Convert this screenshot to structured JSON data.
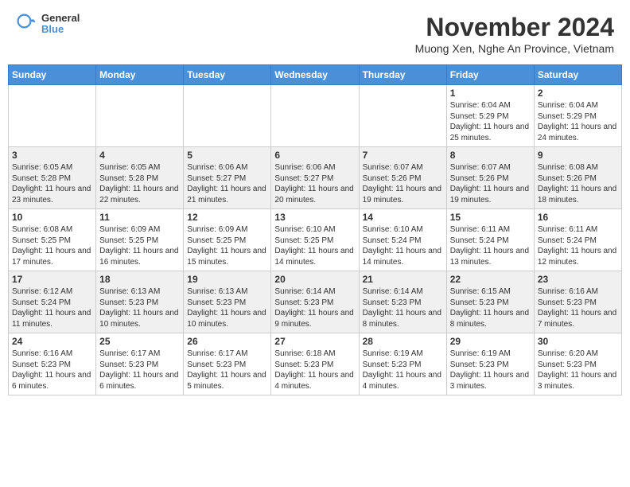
{
  "header": {
    "logo": {
      "text_general": "General",
      "text_blue": "Blue"
    },
    "title": "November 2024",
    "location": "Muong Xen, Nghe An Province, Vietnam"
  },
  "calendar": {
    "weekdays": [
      "Sunday",
      "Monday",
      "Tuesday",
      "Wednesday",
      "Thursday",
      "Friday",
      "Saturday"
    ],
    "weeks": [
      [
        {
          "day": "",
          "info": ""
        },
        {
          "day": "",
          "info": ""
        },
        {
          "day": "",
          "info": ""
        },
        {
          "day": "",
          "info": ""
        },
        {
          "day": "",
          "info": ""
        },
        {
          "day": "1",
          "info": "Sunrise: 6:04 AM\nSunset: 5:29 PM\nDaylight: 11 hours\nand 25 minutes."
        },
        {
          "day": "2",
          "info": "Sunrise: 6:04 AM\nSunset: 5:29 PM\nDaylight: 11 hours\nand 24 minutes."
        }
      ],
      [
        {
          "day": "3",
          "info": "Sunrise: 6:05 AM\nSunset: 5:28 PM\nDaylight: 11 hours\nand 23 minutes."
        },
        {
          "day": "4",
          "info": "Sunrise: 6:05 AM\nSunset: 5:28 PM\nDaylight: 11 hours\nand 22 minutes."
        },
        {
          "day": "5",
          "info": "Sunrise: 6:06 AM\nSunset: 5:27 PM\nDaylight: 11 hours\nand 21 minutes."
        },
        {
          "day": "6",
          "info": "Sunrise: 6:06 AM\nSunset: 5:27 PM\nDaylight: 11 hours\nand 20 minutes."
        },
        {
          "day": "7",
          "info": "Sunrise: 6:07 AM\nSunset: 5:26 PM\nDaylight: 11 hours\nand 19 minutes."
        },
        {
          "day": "8",
          "info": "Sunrise: 6:07 AM\nSunset: 5:26 PM\nDaylight: 11 hours\nand 19 minutes."
        },
        {
          "day": "9",
          "info": "Sunrise: 6:08 AM\nSunset: 5:26 PM\nDaylight: 11 hours\nand 18 minutes."
        }
      ],
      [
        {
          "day": "10",
          "info": "Sunrise: 6:08 AM\nSunset: 5:25 PM\nDaylight: 11 hours\nand 17 minutes."
        },
        {
          "day": "11",
          "info": "Sunrise: 6:09 AM\nSunset: 5:25 PM\nDaylight: 11 hours\nand 16 minutes."
        },
        {
          "day": "12",
          "info": "Sunrise: 6:09 AM\nSunset: 5:25 PM\nDaylight: 11 hours\nand 15 minutes."
        },
        {
          "day": "13",
          "info": "Sunrise: 6:10 AM\nSunset: 5:25 PM\nDaylight: 11 hours\nand 14 minutes."
        },
        {
          "day": "14",
          "info": "Sunrise: 6:10 AM\nSunset: 5:24 PM\nDaylight: 11 hours\nand 14 minutes."
        },
        {
          "day": "15",
          "info": "Sunrise: 6:11 AM\nSunset: 5:24 PM\nDaylight: 11 hours\nand 13 minutes."
        },
        {
          "day": "16",
          "info": "Sunrise: 6:11 AM\nSunset: 5:24 PM\nDaylight: 11 hours\nand 12 minutes."
        }
      ],
      [
        {
          "day": "17",
          "info": "Sunrise: 6:12 AM\nSunset: 5:24 PM\nDaylight: 11 hours\nand 11 minutes."
        },
        {
          "day": "18",
          "info": "Sunrise: 6:13 AM\nSunset: 5:23 PM\nDaylight: 11 hours\nand 10 minutes."
        },
        {
          "day": "19",
          "info": "Sunrise: 6:13 AM\nSunset: 5:23 PM\nDaylight: 11 hours\nand 10 minutes."
        },
        {
          "day": "20",
          "info": "Sunrise: 6:14 AM\nSunset: 5:23 PM\nDaylight: 11 hours\nand 9 minutes."
        },
        {
          "day": "21",
          "info": "Sunrise: 6:14 AM\nSunset: 5:23 PM\nDaylight: 11 hours\nand 8 minutes."
        },
        {
          "day": "22",
          "info": "Sunrise: 6:15 AM\nSunset: 5:23 PM\nDaylight: 11 hours\nand 8 minutes."
        },
        {
          "day": "23",
          "info": "Sunrise: 6:16 AM\nSunset: 5:23 PM\nDaylight: 11 hours\nand 7 minutes."
        }
      ],
      [
        {
          "day": "24",
          "info": "Sunrise: 6:16 AM\nSunset: 5:23 PM\nDaylight: 11 hours\nand 6 minutes."
        },
        {
          "day": "25",
          "info": "Sunrise: 6:17 AM\nSunset: 5:23 PM\nDaylight: 11 hours\nand 6 minutes."
        },
        {
          "day": "26",
          "info": "Sunrise: 6:17 AM\nSunset: 5:23 PM\nDaylight: 11 hours\nand 5 minutes."
        },
        {
          "day": "27",
          "info": "Sunrise: 6:18 AM\nSunset: 5:23 PM\nDaylight: 11 hours\nand 4 minutes."
        },
        {
          "day": "28",
          "info": "Sunrise: 6:19 AM\nSunset: 5:23 PM\nDaylight: 11 hours\nand 4 minutes."
        },
        {
          "day": "29",
          "info": "Sunrise: 6:19 AM\nSunset: 5:23 PM\nDaylight: 11 hours\nand 3 minutes."
        },
        {
          "day": "30",
          "info": "Sunrise: 6:20 AM\nSunset: 5:23 PM\nDaylight: 11 hours\nand 3 minutes."
        }
      ]
    ]
  }
}
